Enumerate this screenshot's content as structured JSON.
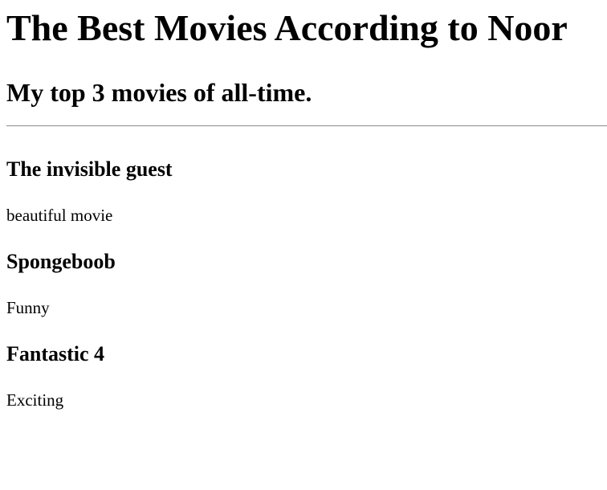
{
  "header": {
    "title": "The Best Movies According to Noor",
    "subtitle": "My top 3 movies of all-time."
  },
  "movies": [
    {
      "title": "The invisible guest",
      "description": "beautiful movie"
    },
    {
      "title": "Spongeboob",
      "description": "Funny"
    },
    {
      "title": "Fantastic 4",
      "description": "Exciting"
    }
  ]
}
